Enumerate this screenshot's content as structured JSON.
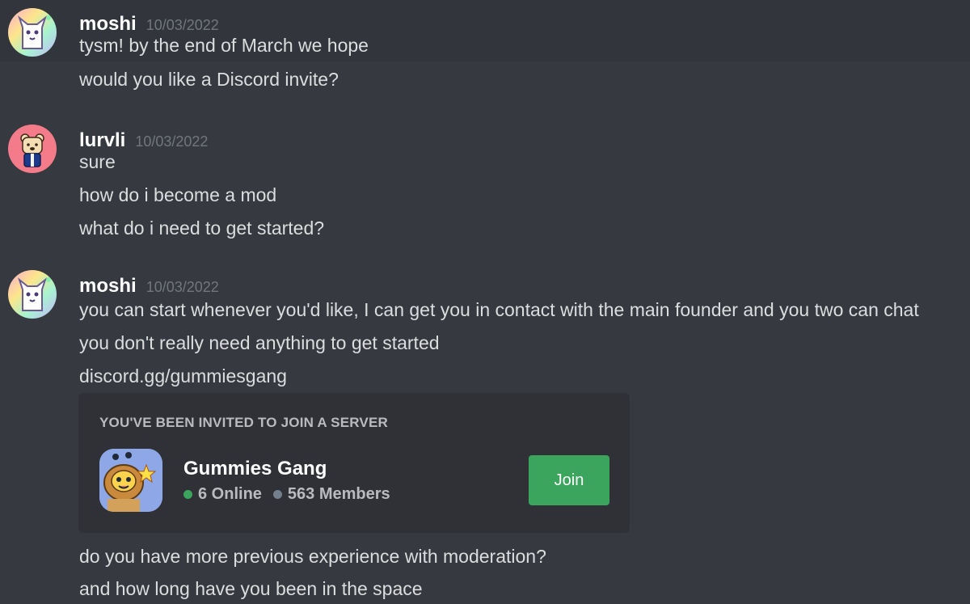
{
  "messages": [
    {
      "username": "moshi",
      "timestamp": "10/03/2022",
      "avatar_icon": "rainbow-cat-avatar",
      "lines": [
        "tysm! by the end of March we hope",
        "would you like a Discord invite?"
      ]
    },
    {
      "username": "lurvli",
      "timestamp": "10/03/2022",
      "avatar_icon": "bear-avatar",
      "lines": [
        "sure",
        "how do i become a mod",
        "what do i need to get started?"
      ]
    },
    {
      "username": "moshi",
      "timestamp": "10/03/2022",
      "avatar_icon": "rainbow-cat-avatar",
      "lines": [
        "you can start whenever you'd like, I can get you in contact with the main founder and you two can chat",
        "you don't really need anything to get started",
        "discord.gg/gummiesgang"
      ],
      "after_lines": [
        "do you have more previous experience with moderation?",
        "and how long have you been in the space"
      ]
    }
  ],
  "invite": {
    "title": "YOU'VE BEEN INVITED TO JOIN A SERVER",
    "server_name": "Gummies Gang",
    "online": "6 Online",
    "members": "563 Members",
    "join_label": "Join",
    "server_icon": "bee-bear-icon"
  },
  "colors": {
    "background": "#36393f",
    "card": "#2f3136",
    "join_green": "#3ba55d",
    "online_green": "#3ba55d",
    "members_gray": "#747f8d"
  }
}
